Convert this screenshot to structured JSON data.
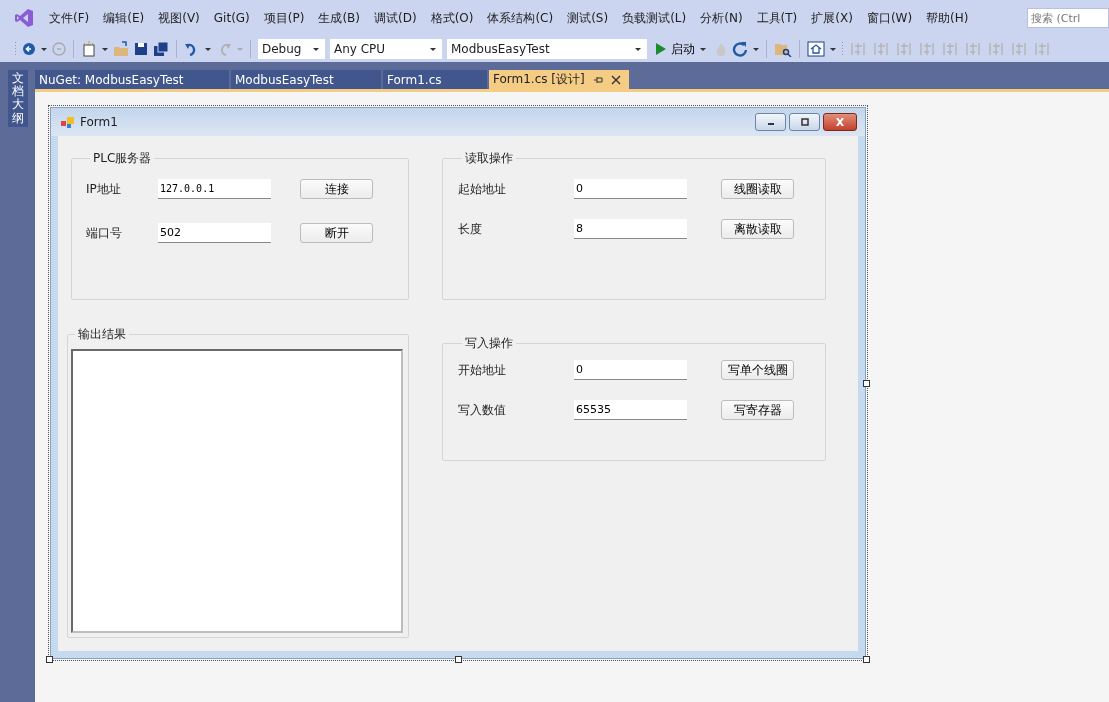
{
  "menu": [
    "文件(F)",
    "编辑(E)",
    "视图(V)",
    "Git(G)",
    "项目(P)",
    "生成(B)",
    "调试(D)",
    "格式(O)",
    "体系结构(C)",
    "测试(S)",
    "负载测试(L)",
    "分析(N)",
    "工具(T)",
    "扩展(X)",
    "窗口(W)",
    "帮助(H)"
  ],
  "search": {
    "placeholder": "搜索 (Ctrl"
  },
  "toolbar": {
    "configuration": "Debug",
    "platform": "Any CPU",
    "project": "ModbusEasyTest",
    "start": "启动"
  },
  "side_panel": {
    "label": "文档大纲"
  },
  "tabs": [
    {
      "label": "NuGet: ModbusEasyTest",
      "selected": false
    },
    {
      "label": "ModbusEasyTest",
      "selected": false
    },
    {
      "label": "Form1.cs",
      "selected": false
    },
    {
      "label": "Form1.cs [设计]",
      "selected": true
    }
  ],
  "form": {
    "title": "Form1",
    "left_groups": [
      {
        "kind": "fields",
        "title": "PLC服务器",
        "rows": [
          {
            "label": "IP地址",
            "value": "127.0.0.1",
            "button": "连接"
          },
          {
            "label": "端口号",
            "value": "502",
            "button": "断开"
          }
        ]
      },
      {
        "kind": "output",
        "title": "输出结果"
      }
    ],
    "right_groups": [
      {
        "kind": "fields",
        "title": "读取操作",
        "rows": [
          {
            "label": "起始地址",
            "value": "0",
            "button": "线圈读取"
          },
          {
            "label": "长度",
            "value": "8",
            "button": "离散读取"
          }
        ]
      },
      {
        "kind": "fields",
        "title": "写入操作",
        "rows": [
          {
            "label": "开始地址",
            "value": "0",
            "button": "写单个线圈"
          },
          {
            "label": "写入数值",
            "value": "65535",
            "button": "写寄存器"
          }
        ]
      }
    ]
  }
}
